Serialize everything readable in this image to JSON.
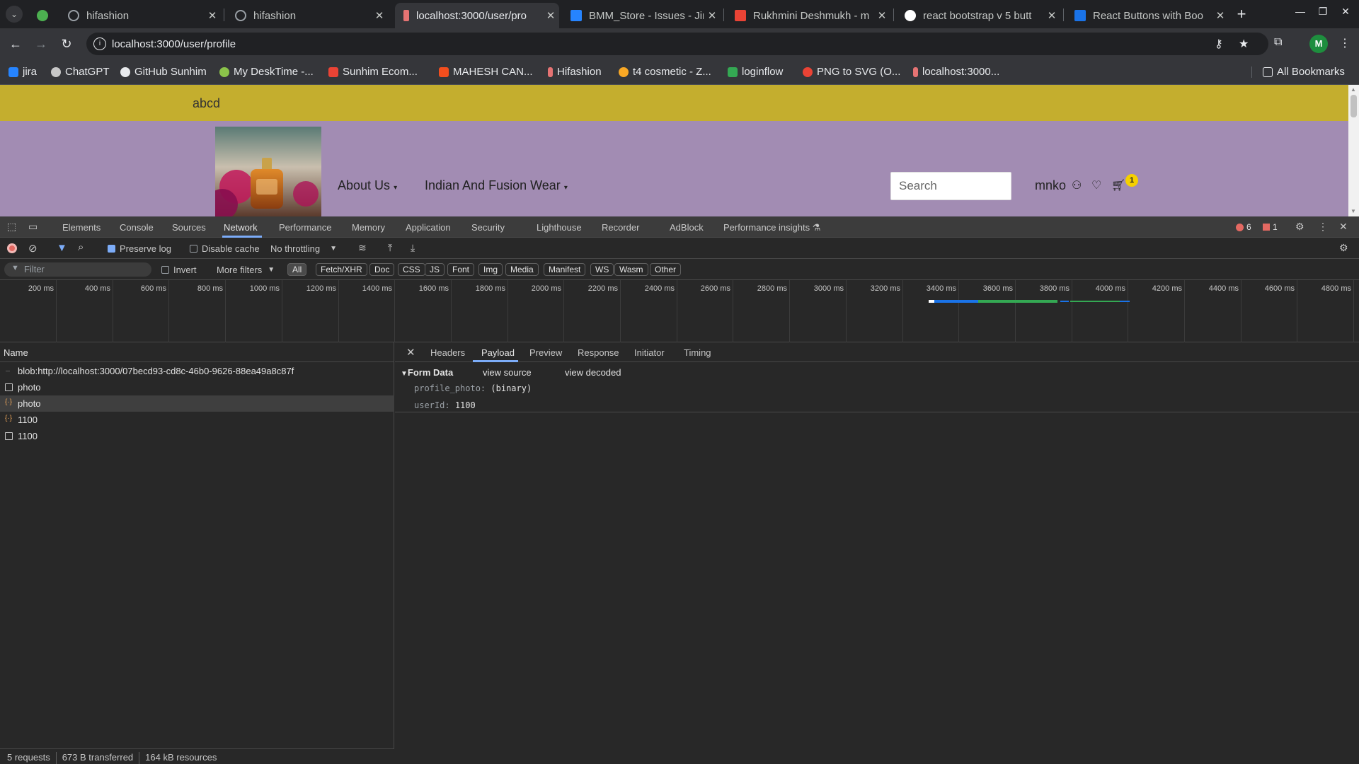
{
  "browser": {
    "tabs": [
      {
        "title": "",
        "favicon_color": "#4caf50"
      },
      {
        "title": "hifashion",
        "favicon_color": "#9aa0a6"
      },
      {
        "title": "hifashion",
        "favicon_color": "#9aa0a6"
      },
      {
        "title": "localhost:3000/user/pro",
        "favicon_color": "#e57373",
        "active": true
      },
      {
        "title": "BMM_Store - Issues - Jir",
        "favicon_color": "#2684ff"
      },
      {
        "title": "Rukhmini Deshmukh - m",
        "favicon_color": "#ea4335"
      },
      {
        "title": "react bootstrap v 5 butt",
        "favicon_color": "#ffffff"
      },
      {
        "title": "React Buttons with Boo",
        "favicon_color": "#1a73e8"
      }
    ],
    "url": "localhost:3000/user/profile",
    "profile_initial": "M",
    "bookmarks": [
      {
        "label": "jira",
        "color": "#2684ff"
      },
      {
        "label": "ChatGPT",
        "color": "#c7c7c7"
      },
      {
        "label": "GitHub Sunhim",
        "color": "#e8eaed"
      },
      {
        "label": "My DeskTime -...",
        "color": "#8bc34a"
      },
      {
        "label": "Sunhim Ecom...",
        "color": "#ea4335"
      },
      {
        "label": "MAHESH CAN...",
        "color": "#f24e1e"
      },
      {
        "label": "Hifashion",
        "color": "#e57373"
      },
      {
        "label": "t4 cosmetic - Z...",
        "color": "#f9a825"
      },
      {
        "label": "loginflow",
        "color": "#34a853"
      },
      {
        "label": "PNG to SVG (O...",
        "color": "#ea4335"
      },
      {
        "label": "localhost:3000...",
        "color": "#e57373"
      }
    ],
    "all_bookmarks": "All Bookmarks"
  },
  "page": {
    "topbar_text": "abcd",
    "nav": [
      "About Us",
      "Indian And Fusion Wear"
    ],
    "search_placeholder": "Search",
    "username": "mnko",
    "cart_count": "1"
  },
  "devtools": {
    "tabs": [
      "Elements",
      "Console",
      "Sources",
      "Network",
      "Performance",
      "Memory",
      "Application",
      "Security",
      "Lighthouse",
      "Recorder",
      "AdBlock",
      "Performance insights"
    ],
    "active_tab": "Network",
    "error_count": "6",
    "issue_count": "1",
    "network_toolbar": {
      "preserve_log": "Preserve log",
      "disable_cache": "Disable cache",
      "throttling": "No throttling"
    },
    "filter": {
      "placeholder": "Filter",
      "invert": "Invert",
      "more_filters": "More filters",
      "types": [
        "All",
        "Fetch/XHR",
        "Doc",
        "CSS",
        "JS",
        "Font",
        "Img",
        "Media",
        "Manifest",
        "WS",
        "Wasm",
        "Other"
      ]
    },
    "timeline_ticks": [
      "200 ms",
      "400 ms",
      "600 ms",
      "800 ms",
      "1000 ms",
      "1200 ms",
      "1400 ms",
      "1600 ms",
      "1800 ms",
      "2000 ms",
      "2200 ms",
      "2400 ms",
      "2600 ms",
      "2800 ms",
      "3000 ms",
      "3200 ms",
      "3400 ms",
      "3600 ms",
      "3800 ms",
      "4000 ms",
      "4200 ms",
      "4400 ms",
      "4600 ms",
      "4800 ms"
    ],
    "list_header": "Name",
    "requests": [
      {
        "name": "blob:http://localhost:3000/07becd93-cd8c-46b0-9626-88ea49a8c87f",
        "type": "line"
      },
      {
        "name": "photo",
        "type": "doc"
      },
      {
        "name": "photo",
        "type": "xhr",
        "selected": true
      },
      {
        "name": "1100",
        "type": "xhr"
      },
      {
        "name": "1100",
        "type": "doc"
      }
    ],
    "detail_tabs": [
      "Headers",
      "Payload",
      "Preview",
      "Response",
      "Initiator",
      "Timing"
    ],
    "active_detail_tab": "Payload",
    "payload": {
      "section": "Form Data",
      "view_source": "view source",
      "view_decoded": "view decoded",
      "fields": [
        {
          "key": "profile_photo:",
          "value": "(binary)"
        },
        {
          "key": "userId:",
          "value": "1100"
        }
      ]
    },
    "status": {
      "requests": "5 requests",
      "transferred": "673 B transferred",
      "resources": "164 kB resources"
    }
  }
}
